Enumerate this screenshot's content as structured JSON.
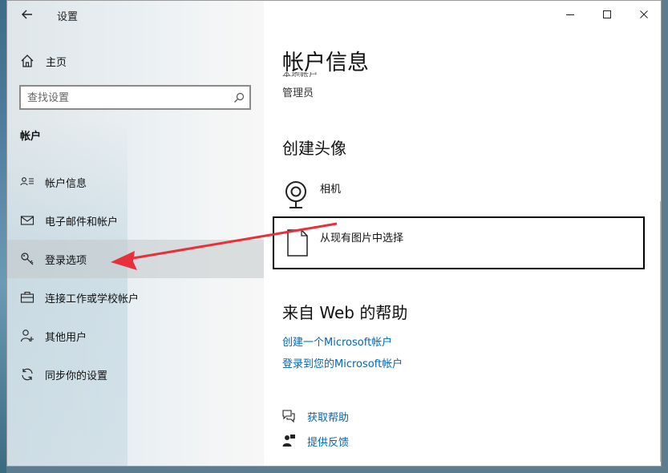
{
  "window": {
    "title": "设置",
    "back_icon": "back-arrow-icon",
    "minimize_glyph": "—",
    "maximize_glyph": "☐",
    "close_glyph": "✕"
  },
  "sidebar": {
    "home_label": "主页",
    "search_placeholder": "查找设置",
    "section_title": "帐户",
    "items": [
      {
        "label": "帐户信息",
        "icon": "person-card-icon",
        "selected": false
      },
      {
        "label": "电子邮件和帐户",
        "icon": "mail-icon",
        "selected": false
      },
      {
        "label": "登录选项",
        "icon": "key-icon",
        "selected": true
      },
      {
        "label": "连接工作或学校帐户",
        "icon": "briefcase-icon",
        "selected": false
      },
      {
        "label": "其他用户",
        "icon": "person-add-icon",
        "selected": false
      },
      {
        "label": "同步你的设置",
        "icon": "sync-icon",
        "selected": false
      }
    ]
  },
  "main": {
    "page_title": "帐户信息",
    "account_line_cut": "本地帐户",
    "role": "管理员",
    "avatar_heading": "创建头像",
    "camera_label": "相机",
    "choose_label": "从现有图片中选择",
    "web_help_heading": "来自 Web 的帮助",
    "links": [
      "创建一个Microsoft帐户",
      "登录到您的Microsoft帐户"
    ],
    "get_help_label": "获取帮助",
    "feedback_label": "提供反馈"
  },
  "colors": {
    "accent": "#0067c0",
    "link": "#0067b8",
    "annotation_arrow": "#e8303a"
  }
}
